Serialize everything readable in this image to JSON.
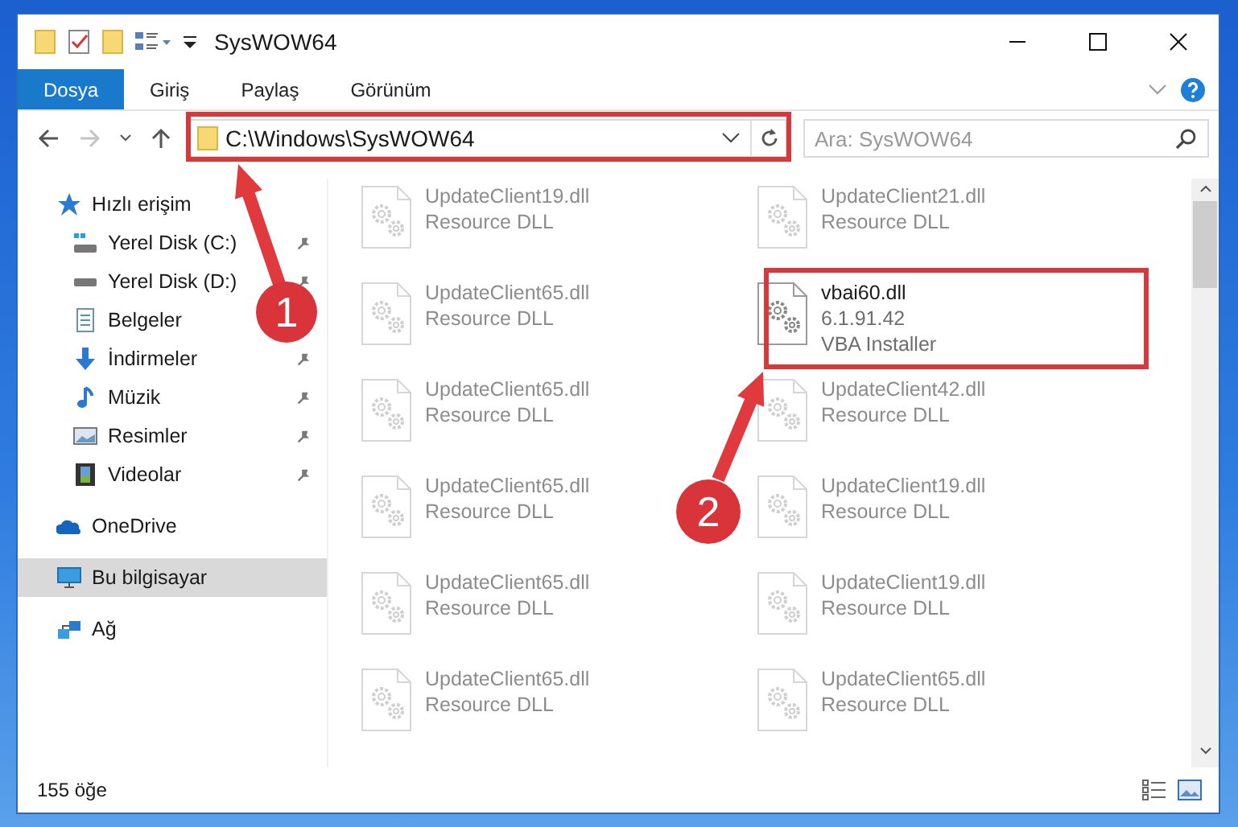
{
  "window": {
    "title": "SysWOW64"
  },
  "ribbon_tabs": [
    {
      "label": "Dosya",
      "selected": true
    },
    {
      "label": "Giriş",
      "selected": false
    },
    {
      "label": "Paylaş",
      "selected": false
    },
    {
      "label": "Görünüm",
      "selected": false
    }
  ],
  "navigation": {
    "back_disabled": false,
    "forward_disabled": true
  },
  "address_bar": {
    "path": "C:\\Windows\\SysWOW64"
  },
  "search": {
    "placeholder": "Ara: SysWOW64"
  },
  "sidebar": {
    "items": [
      {
        "label": "Hızlı erişim",
        "selected": false,
        "children": [
          {
            "label": "Yerel Disk (C:)",
            "pinned": true,
            "selected": false
          },
          {
            "label": "Yerel Disk (D:)",
            "pinned": true,
            "selected": false
          },
          {
            "label": "Belgeler",
            "selected": false
          },
          {
            "label": "İndirmeler",
            "pinned": true,
            "selected": false
          },
          {
            "label": "Müzik",
            "pinned": true,
            "selected": false
          },
          {
            "label": "Resimler",
            "pinned": true,
            "selected": false
          },
          {
            "label": "Videolar",
            "pinned": true,
            "selected": false
          }
        ]
      },
      {
        "label": "OneDrive",
        "selected": false
      },
      {
        "label": "Bu bilgisayar",
        "selected": true
      },
      {
        "label": "Ağ",
        "selected": false
      }
    ]
  },
  "files": [
    {
      "name": "UpdateClient19.dll",
      "details": [
        "Resource DLL"
      ],
      "faded": true
    },
    {
      "name": "UpdateClient21.dll",
      "details": [
        "Resource DLL"
      ],
      "faded": true
    },
    {
      "name": "UpdateClient65.dll",
      "details": [
        "Resource DLL"
      ],
      "faded": true
    },
    {
      "name": "vbai60.dll",
      "details": [
        "6.1.91.42",
        "VBA Installer"
      ],
      "faded": false
    },
    {
      "name": "UpdateClient65.dll",
      "details": [
        "Resource DLL"
      ],
      "faded": true
    },
    {
      "name": "UpdateClient42.dll",
      "details": [
        "Resource DLL"
      ],
      "faded": true
    },
    {
      "name": "UpdateClient65.dll",
      "details": [
        "Resource DLL"
      ],
      "faded": true
    },
    {
      "name": "UpdateClient19.dll",
      "details": [
        "Resource DLL"
      ],
      "faded": true
    },
    {
      "name": "UpdateClient65.dll",
      "details": [
        "Resource DLL"
      ],
      "faded": true
    },
    {
      "name": "UpdateClient19.dll",
      "details": [
        "Resource DLL"
      ],
      "faded": true
    },
    {
      "name": "UpdateClient65.dll",
      "details": [
        "Resource DLL"
      ],
      "faded": true
    },
    {
      "name": "UpdateClient65.dll",
      "details": [
        "Resource DLL"
      ],
      "faded": true
    }
  ],
  "status_bar": {
    "item_count": "155 öğe"
  },
  "annotations": [
    {
      "number": "1"
    },
    {
      "number": "2"
    }
  ]
}
